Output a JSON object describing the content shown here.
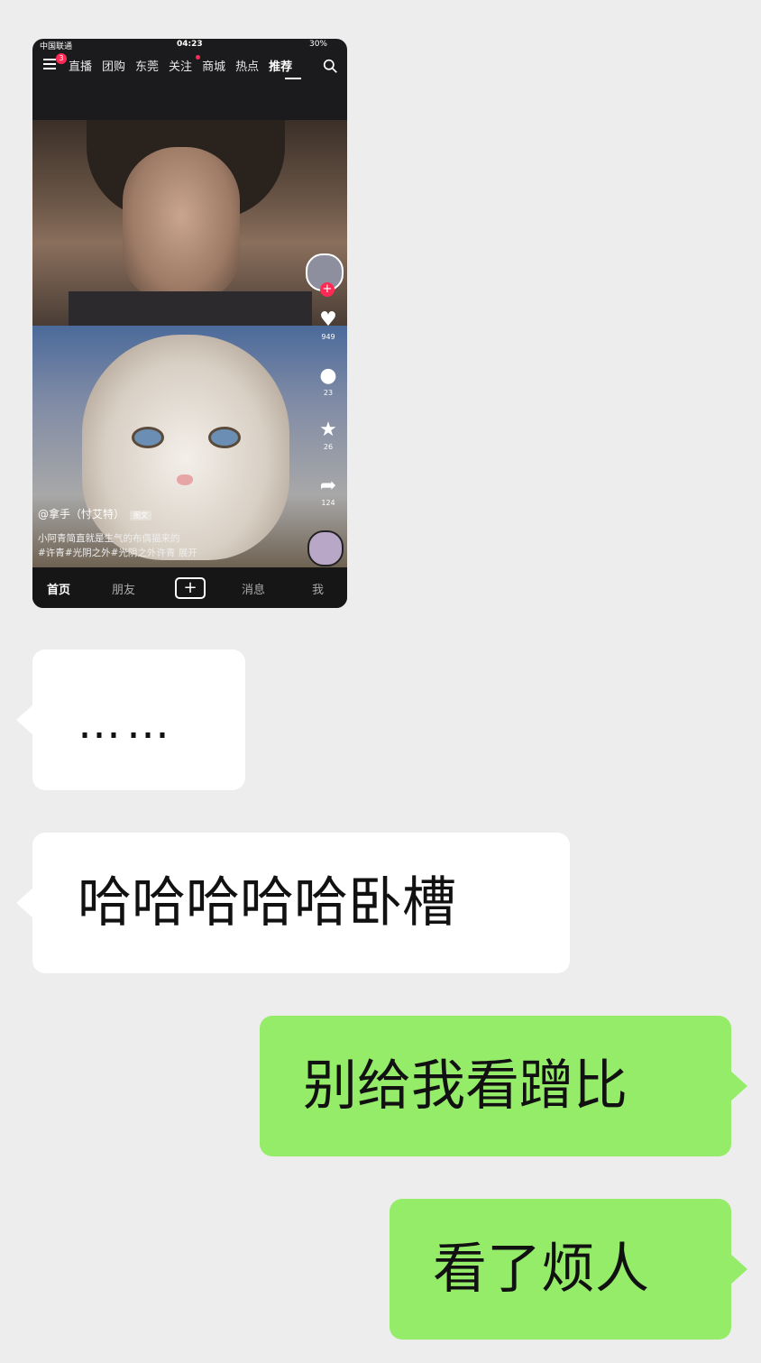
{
  "screenshot": {
    "status": {
      "carrier": "中国联通",
      "time": "04:23",
      "battery": "30%"
    },
    "badge_count": "3",
    "top_tabs": [
      "直播",
      "团购",
      "东莞",
      "关注",
      "商城",
      "热点",
      "推荐"
    ],
    "active_tab": "推荐",
    "side_counts": {
      "likes": "949",
      "comments": "23",
      "favorites": "26",
      "shares": "124"
    },
    "author": "@拿手（忖艾特）",
    "post_type": "图文",
    "caption_line1": "小阿青简直就是生气的布偶猫来的",
    "caption_line2": "#许青#光阴之外#光阴之外许青  展开",
    "bottom_nav": [
      "首页",
      "朋友",
      "+",
      "消息",
      "我"
    ]
  },
  "messages": [
    {
      "side": "left",
      "text": "……"
    },
    {
      "side": "left",
      "text": "哈哈哈哈哈卧槽"
    },
    {
      "side": "right",
      "text": "别给我看蹭比"
    },
    {
      "side": "right",
      "text": "看了烦人"
    }
  ],
  "colors": {
    "background": "#ededed",
    "incoming_bubble": "#ffffff",
    "outgoing_bubble": "#95ec69",
    "accent_red": "#ff2b55"
  }
}
